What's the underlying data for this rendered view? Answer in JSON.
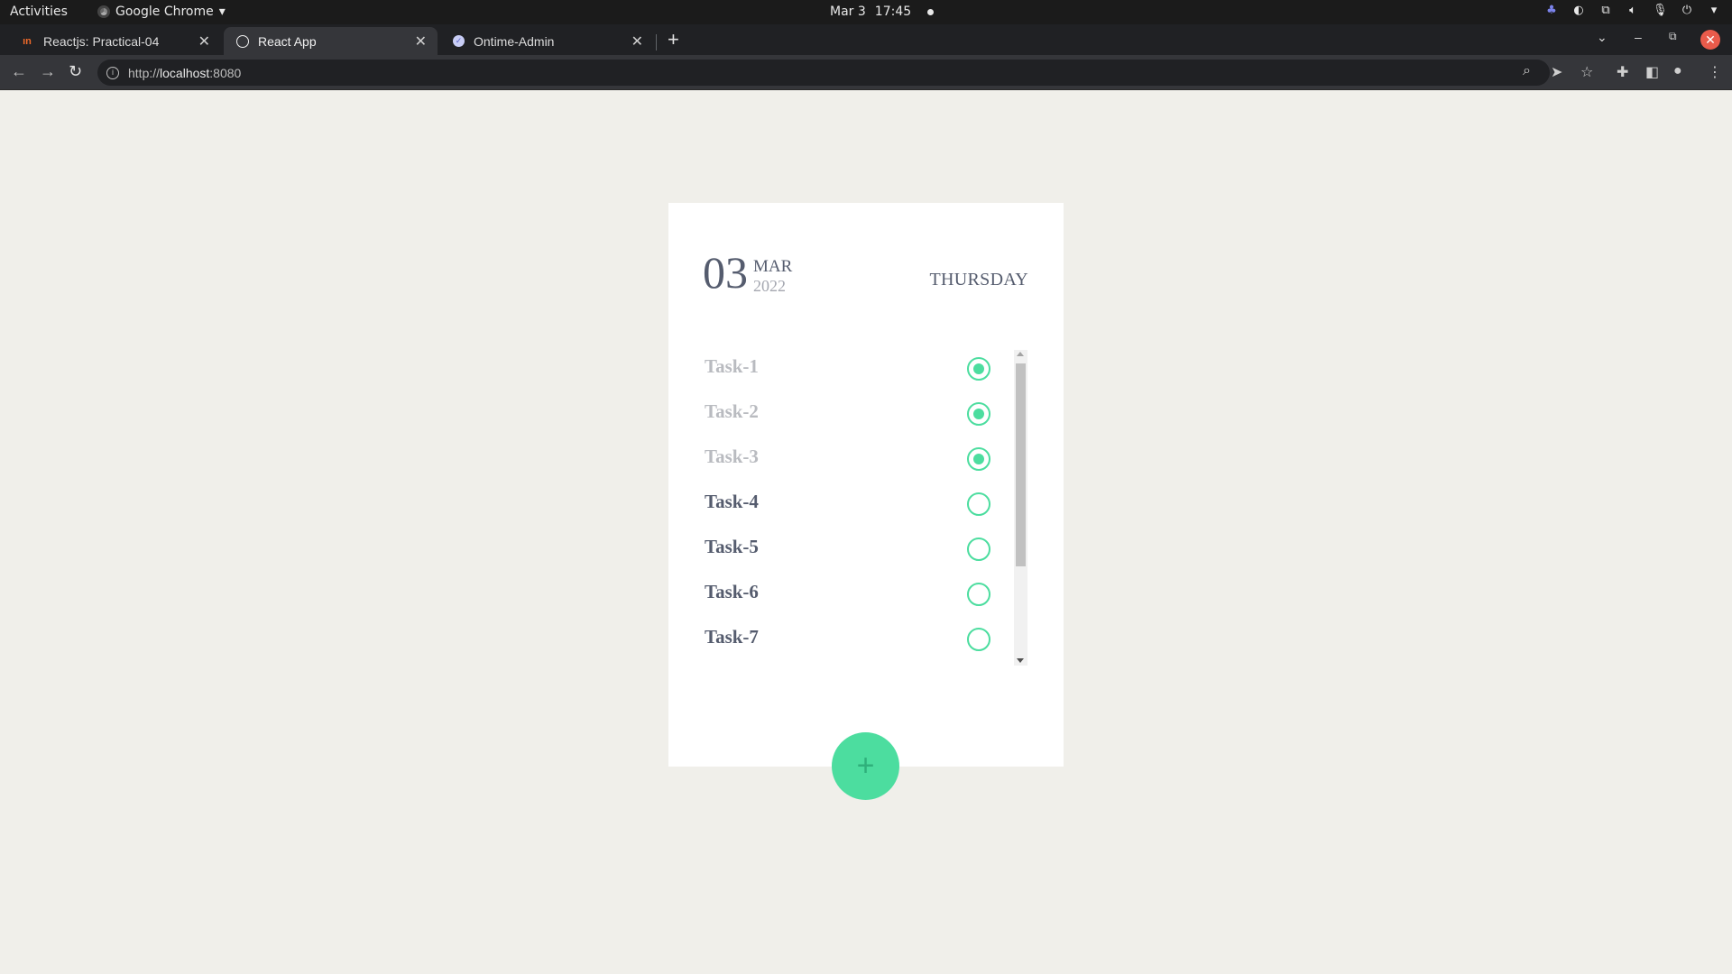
{
  "system_bar": {
    "activities": "Activities",
    "app_name": "Google Chrome",
    "date": "Mar 3",
    "time": "17:45"
  },
  "tabs": [
    {
      "title": "Reactjs: Practical-04",
      "active": false
    },
    {
      "title": "React App",
      "active": true
    },
    {
      "title": "Ontime-Admin",
      "active": false
    }
  ],
  "address_bar": {
    "scheme": "http://",
    "host": "localhost",
    "port": ":8080"
  },
  "card": {
    "day": "03",
    "month": "MAR",
    "year": "2022",
    "weekday": "THURSDAY"
  },
  "tasks": [
    {
      "label": "Task-1",
      "done": true
    },
    {
      "label": "Task-2",
      "done": true
    },
    {
      "label": "Task-3",
      "done": true
    },
    {
      "label": "Task-4",
      "done": false
    },
    {
      "label": "Task-5",
      "done": false
    },
    {
      "label": "Task-6",
      "done": false
    },
    {
      "label": "Task-7",
      "done": false
    }
  ],
  "fab": {
    "symbol": "+"
  },
  "colors": {
    "accent": "#4cdd9f",
    "text_primary": "#555c6e",
    "text_muted": "#b9bbc0",
    "background": "#f0efea"
  }
}
